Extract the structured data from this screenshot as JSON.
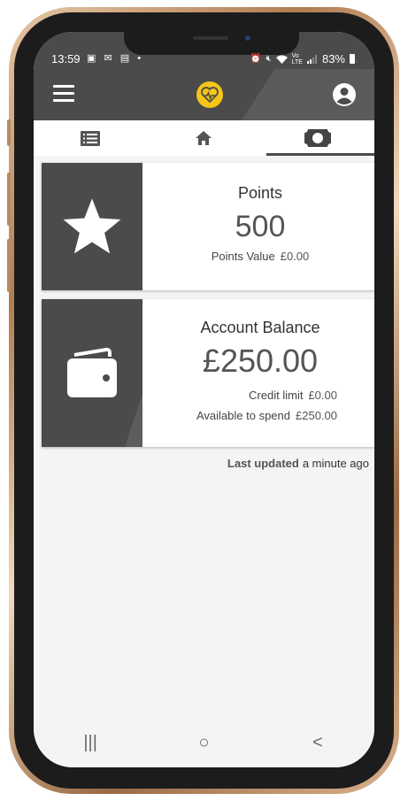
{
  "status_bar": {
    "time": "13:59",
    "left_icons": [
      "image-icon",
      "mail-icon",
      "video-icon",
      "dot-icon"
    ],
    "right_icons": [
      "alarm-icon",
      "mute-icon",
      "wifi-icon",
      "volte-icon",
      "signal-icon"
    ],
    "battery": "83%"
  },
  "app_bar": {
    "menu_icon": "hamburger-icon",
    "logo_icon": "heart-pulse-logo",
    "account_icon": "account-circle-icon",
    "accent_color": "#f5c518"
  },
  "tabs": [
    {
      "icon": "list-icon",
      "active": false
    },
    {
      "icon": "home-icon",
      "active": false
    },
    {
      "icon": "money-icon",
      "active": true
    }
  ],
  "points_card": {
    "icon": "star-icon",
    "title": "Points",
    "value": "500",
    "value_label": "Points Value",
    "value_amount": "£0.00"
  },
  "balance_card": {
    "icon": "wallet-icon",
    "title": "Account Balance",
    "value": "£250.00",
    "credit_label": "Credit limit",
    "credit_amount": "£0.00",
    "available_label": "Available to spend",
    "available_amount": "£250.00"
  },
  "last_updated": {
    "label": "Last updated",
    "value": "a minute ago"
  },
  "nav_bar": {
    "recents_glyph": "|||",
    "home_glyph": "○",
    "back_glyph": "<"
  }
}
